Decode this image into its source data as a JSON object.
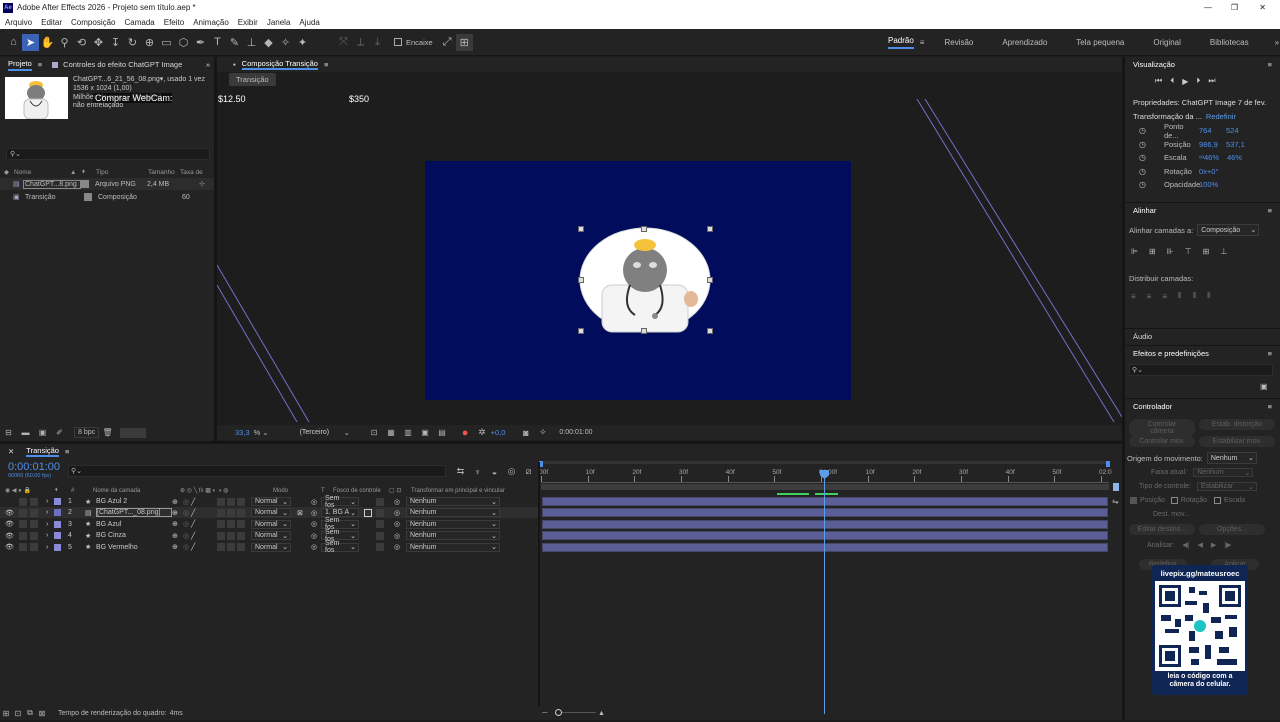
{
  "app": {
    "title": "Adobe After Effects 2026 - Projeto sem título.aep *",
    "logo": "Ae"
  },
  "menu": [
    "Arquivo",
    "Editar",
    "Composição",
    "Camada",
    "Efeito",
    "Animação",
    "Exibir",
    "Janela",
    "Ajuda"
  ],
  "toolbar": {
    "snap_label": "Encaixe",
    "workspaces": [
      "Padrão",
      "Revisão",
      "Aprendizado",
      "Tela pequena",
      "Original",
      "Bibliotecas"
    ]
  },
  "project": {
    "tab": "Projeto",
    "effects_tab": "Controles do efeito ChatGPT Image",
    "file_name": "ChatGPT...6_21_56_08.png",
    "used": ", usado 1 vez",
    "dimensions": "1536 x 1024 (1,00)",
    "colors": "Milhões de cores+ (Simples)",
    "interlace": "não entrelaçado",
    "columns": [
      "Nome",
      "Tipo",
      "Tamanho",
      "Taxa de"
    ],
    "items": [
      {
        "name": "ChatGPT...8.png",
        "type": "Arquivo PNG",
        "size": "2,4 MB",
        "rate": ""
      },
      {
        "name": "Transição",
        "type": "Composição",
        "size": "",
        "rate": "60"
      }
    ],
    "bpc": "8 bpc"
  },
  "overlay": {
    "webcam": "Comprar WebCam:",
    "price1": "$12.50",
    "price2": "$350"
  },
  "composition": {
    "tab": "Composição Transição",
    "sub_tab": "Transição",
    "zoom": "33,3",
    "zoom_unit": "%",
    "view": "(Terceiro)",
    "exposure": "+0,0",
    "timecode": "0:00:01:00"
  },
  "timeline": {
    "tab": "Transição",
    "timecode": "0:00:01:00",
    "frames": "00060 (60.00 fps)",
    "columns": [
      "#",
      "Nome da camada",
      "Modo",
      "T",
      "Fosco de controle",
      "Transformar em principal e vincular"
    ],
    "layers": [
      {
        "n": "1",
        "name": "BG Azul 2",
        "mode": "Normal",
        "matte": "Sem fos",
        "parent": "Nenhum",
        "color": "#8a8ad8"
      },
      {
        "n": "2",
        "name": "[ChatGPT..._08.png]",
        "mode": "Normal",
        "matte": "1. BG A",
        "parent": "Nenhum",
        "color": "#6f6fbf"
      },
      {
        "n": "3",
        "name": "BG Azul",
        "mode": "Normal",
        "matte": "Sem fos",
        "parent": "Nenhum",
        "color": "#8a8ad8"
      },
      {
        "n": "4",
        "name": "BG Cinza",
        "mode": "Normal",
        "matte": "Sem fos",
        "parent": "Nenhum",
        "color": "#8a8ad8"
      },
      {
        "n": "5",
        "name": "BG Vermelho",
        "mode": "Normal",
        "matte": "Sem fos",
        "parent": "Nenhum",
        "color": "#8a8ad8"
      }
    ],
    "ruler": [
      "00f",
      "10f",
      "20f",
      "30f",
      "40f",
      "50f",
      "01:00f",
      "10f",
      "20f",
      "30f",
      "40f",
      "50f",
      "02:0"
    ],
    "render_time": "Tempo de renderização do quadro:",
    "render_value": "4ms"
  },
  "right": {
    "preview_title": "Visualização",
    "props_title": "Propriedades: ChatGPT Image 7 de fev.",
    "transform": "Transformação da ...",
    "reset": "Redefinir",
    "props": [
      {
        "label": "Ponto de...",
        "v1": "764",
        "v2": "524"
      },
      {
        "label": "Posição",
        "v1": "986,9",
        "v2": "537,1"
      },
      {
        "label": "Escala",
        "v1": "46%",
        "v2": "46%"
      },
      {
        "label": "Rotação",
        "v1": "0x+0°",
        "v2": ""
      },
      {
        "label": "Opacidade",
        "v1": "100%",
        "v2": ""
      }
    ],
    "align_title": "Alinhar",
    "align_to": "Alinhar camadas a:",
    "align_value": "Composição",
    "distribute": "Distribuir camadas:",
    "audio": "Áudio",
    "effects_title": "Efeitos e predefinições",
    "controller_title": "Controlador",
    "controller_buttons": [
      "Controlar câmera",
      "Estab. distorção",
      "Controlar mov.",
      "Estabilizar mov."
    ],
    "motion_origin": "Origem do movimento:",
    "motion_value": "Nenhum",
    "current_track": "Faixa atual:",
    "current_value": "Nenhum",
    "tracker_type": "Tipo de controle:",
    "tracker_value": "Estabilizar",
    "opt_position": "Posição",
    "opt_rotation": "Rotação",
    "opt_scale": "Escala",
    "dest_mov": "Dest. mov...",
    "edit_target": "Editar destino...",
    "options": "Opções...",
    "analyze": "Analisar:",
    "redefine": "Redefinir",
    "apply": "Aplicar",
    "qr_url": "livepix.gg/mateusroec",
    "qr_caption": "leia o código com a câmera do celular."
  }
}
